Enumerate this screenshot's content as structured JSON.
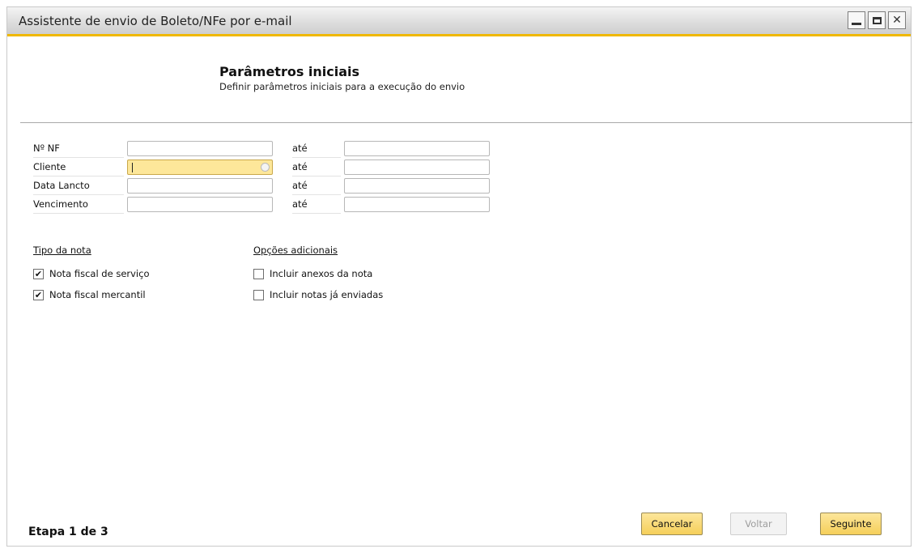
{
  "window": {
    "title": "Assistente de envio de Boleto/NFe por e-mail",
    "controls": {
      "minimize": "minimize-icon",
      "maximize": "maximize-icon",
      "close": "close-icon"
    }
  },
  "header": {
    "title": "Parâmetros iniciais",
    "subtitle": "Definir parâmetros iniciais para a execução do envio"
  },
  "filters": [
    {
      "label": "Nº NF",
      "separator": "até",
      "from": "",
      "to": ""
    },
    {
      "label": "Cliente",
      "separator": "até",
      "from": "",
      "to": ""
    },
    {
      "label": "Data Lancto",
      "separator": "até",
      "from": "",
      "to": ""
    },
    {
      "label": "Vencimento",
      "separator": "até",
      "from": "",
      "to": ""
    }
  ],
  "tipo_nota": {
    "title": "Tipo da nota",
    "options": [
      {
        "label": "Nota fiscal de serviço",
        "checked": true
      },
      {
        "label": "Nota fiscal mercantil",
        "checked": true
      }
    ]
  },
  "opcoes": {
    "title": "Opções adicionais",
    "options": [
      {
        "label": "Incluir anexos da nota",
        "checked": false
      },
      {
        "label": "Incluir notas já enviadas",
        "checked": false
      }
    ]
  },
  "footer": {
    "step": "Etapa 1 de 3",
    "cancel": "Cancelar",
    "back": "Voltar",
    "next": "Seguinte"
  },
  "colors": {
    "accent": "#f0b800",
    "active_field": "#fde79a",
    "primary_button": "#f5cf5a"
  }
}
